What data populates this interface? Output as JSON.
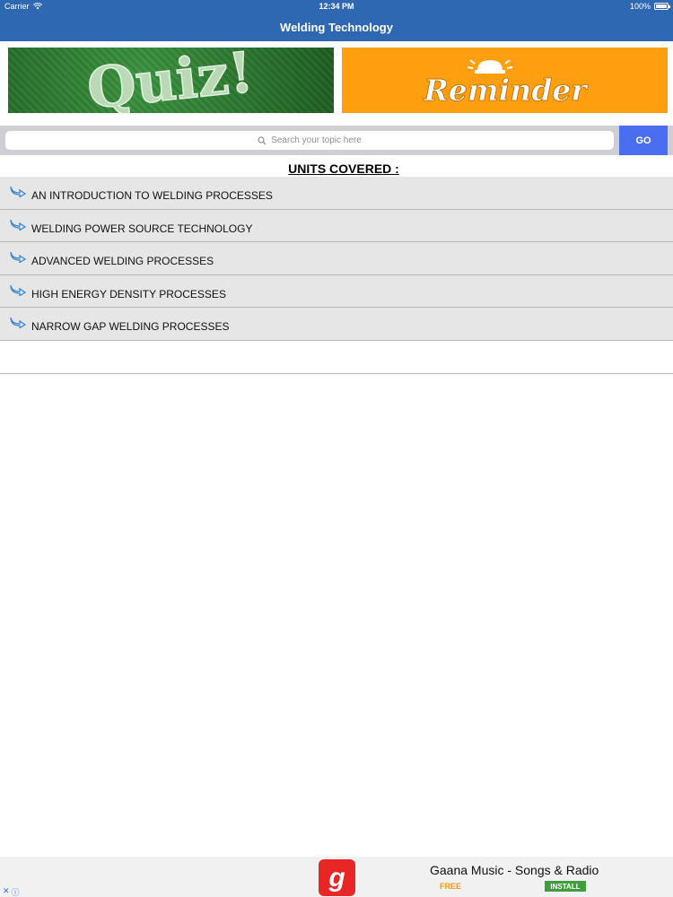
{
  "status_bar": {
    "carrier": "Carrier",
    "time": "12:34 PM",
    "battery": "100%"
  },
  "nav": {
    "title": "Welding Technology"
  },
  "banners": {
    "quiz_text": "Quiz!",
    "reminder_text": "Reminder",
    "quiz_color": "#2b7a2f",
    "reminder_color": "#ff9e0e"
  },
  "search": {
    "placeholder": "Search your topic here",
    "go_label": "GO"
  },
  "units": {
    "heading": "UNITS COVERED :",
    "items": [
      {
        "label": "AN INTRODUCTION TO WELDING PROCESSES"
      },
      {
        "label": "WELDING POWER SOURCE TECHNOLOGY"
      },
      {
        "label": "ADVANCED WELDING PROCESSES"
      },
      {
        "label": "HIGH ENERGY DENSITY PROCESSES"
      },
      {
        "label": "NARROW GAP WELDING PROCESSES"
      }
    ]
  },
  "ad": {
    "logo_letter": "g",
    "title": "Gaana Music - Songs & Radio",
    "price": "FREE",
    "install_label": "INSTALL"
  },
  "colors": {
    "nav": "#2f68b2",
    "go_button": "#4b6ef0",
    "row": "#e6e6e6"
  }
}
